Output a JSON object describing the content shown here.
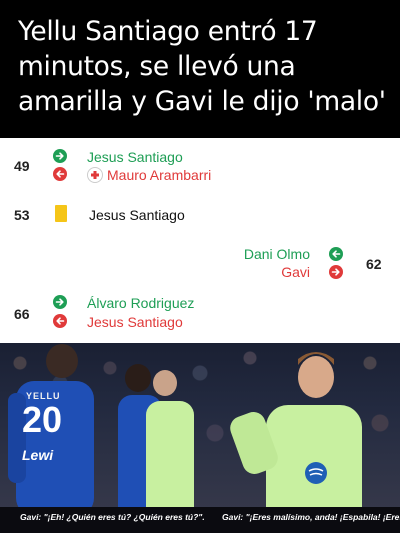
{
  "header": {
    "title": "Yellu Santiago entró 17 minutos, se llevó una amarilla y Gavi le dijo 'malo'"
  },
  "timeline": {
    "events": [
      {
        "minute": "49",
        "in_player": "Jesus Santiago",
        "out_player": "Mauro Arambarri"
      },
      {
        "minute": "53",
        "card_player": "Jesus Santiago"
      },
      {
        "minute": "62",
        "in_player": "Dani Olmo",
        "out_player": "Gavi"
      },
      {
        "minute": "66",
        "in_player": "Álvaro Rodriguez",
        "out_player": "Jesus Santiago"
      }
    ]
  },
  "photo": {
    "jersey_name": "YELLU",
    "jersey_number": "20",
    "sponsor": "Lewi",
    "subtitle_left": "Gavi: \"¡Eh! ¿Quién eres tú? ¿Quién eres tú?\".",
    "subtitle_right": "Gavi: \"¡Eres malísimo, anda! ¡Espabila! ¡Eres m"
  },
  "colors": {
    "in": "#1e9e55",
    "out": "#e03a3a",
    "yellow_card": "#f5c518",
    "getafe": "#1f4fb5",
    "barca_third": "#c8f0a0"
  },
  "icons": {
    "in": "arrow-right-circle-icon",
    "out": "arrow-left-circle-icon",
    "injury": "medical-cross-icon"
  }
}
